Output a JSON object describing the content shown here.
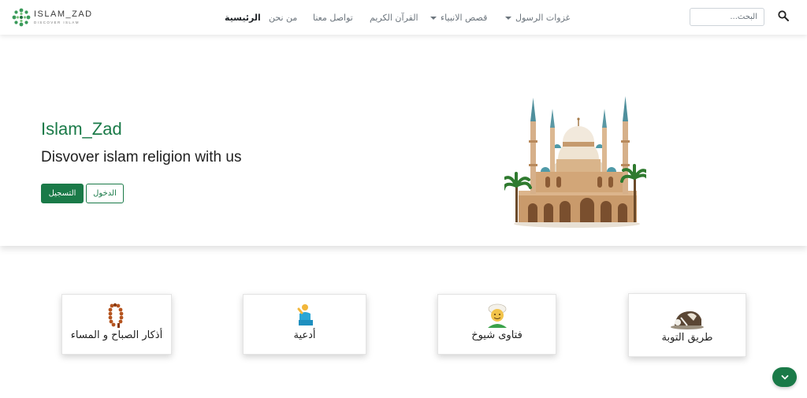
{
  "brand": {
    "name": "ISLAM_ZAD",
    "tagline": "DISCOVER ISLAM"
  },
  "nav": {
    "items": [
      {
        "label": "الرئيسية",
        "active": true
      },
      {
        "label": "من نحن"
      },
      {
        "label": "تواصل معنا"
      },
      {
        "label": "القرآن الكريم"
      },
      {
        "label": "قصص الانبياء",
        "dropdown": true
      },
      {
        "label": "غزوات الرسول",
        "dropdown": true
      }
    ]
  },
  "search": {
    "placeholder": "البحث...",
    "value": ""
  },
  "hero": {
    "title": "Islam_Zad",
    "subtitle": "Disvover islam religion with us",
    "register_label": "التسجيل",
    "login_label": "الدخول"
  },
  "cards": [
    {
      "label": "أذكار الصباح و المساء",
      "icon": "prayer-beads-icon"
    },
    {
      "label": "أدعية",
      "icon": "praying-person-icon"
    },
    {
      "label": "فتاوى شيوخ",
      "icon": "sheikh-turban-icon"
    },
    {
      "label": "طريق التوبة",
      "icon": "prostration-icon"
    }
  ],
  "colors": {
    "primary": "#1a7a48",
    "text": "#1f1f1f",
    "muted": "#6c757d"
  }
}
